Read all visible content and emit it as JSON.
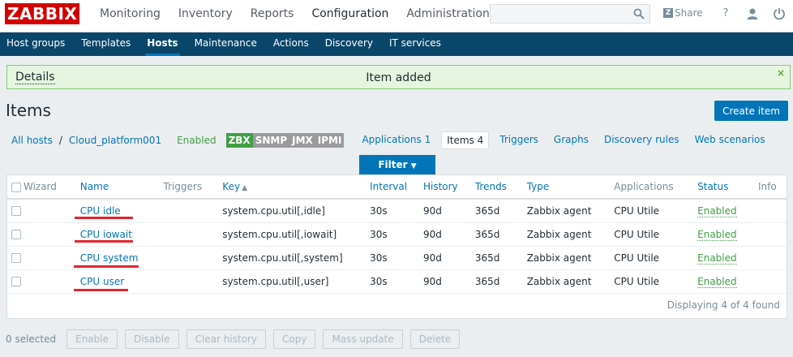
{
  "header": {
    "logo": "ZABBIX",
    "nav": [
      "Monitoring",
      "Inventory",
      "Reports",
      "Configuration",
      "Administration"
    ],
    "active_nav": "Configuration",
    "search_value": "",
    "share_label": "Share",
    "help_icon": "?",
    "share_icon": "Z"
  },
  "subnav": {
    "items": [
      "Host groups",
      "Templates",
      "Hosts",
      "Maintenance",
      "Actions",
      "Discovery",
      "IT services"
    ],
    "active": "Hosts"
  },
  "message": {
    "details": "Details",
    "text": "Item added",
    "close": "×"
  },
  "page": {
    "title": "Items",
    "create_button": "Create item"
  },
  "breadcrumbs": {
    "all_hosts": "All hosts",
    "separator": "/",
    "host": "Cloud_platform001",
    "status": "Enabled",
    "availability": [
      {
        "label": "ZBX",
        "state": "on"
      },
      {
        "label": "SNMP",
        "state": "off"
      },
      {
        "label": "JMX",
        "state": "off"
      },
      {
        "label": "IPMI",
        "state": "off"
      }
    ],
    "tabs": [
      {
        "label": "Applications",
        "count": "1"
      },
      {
        "label": "Items",
        "count": "4"
      },
      {
        "label": "Triggers",
        "count": ""
      },
      {
        "label": "Graphs",
        "count": ""
      },
      {
        "label": "Discovery rules",
        "count": ""
      },
      {
        "label": "Web scenarios",
        "count": ""
      }
    ]
  },
  "filter": {
    "label": "Filter",
    "arrow": "▼"
  },
  "table": {
    "columns": {
      "wizard": "Wizard",
      "name": "Name",
      "triggers": "Triggers",
      "key": "Key",
      "key_sort": "▲",
      "interval": "Interval",
      "history": "History",
      "trends": "Trends",
      "type": "Type",
      "applications": "Applications",
      "status": "Status",
      "info": "Info"
    },
    "rows": [
      {
        "name": "CPU idle",
        "key": "system.cpu.util[,idle]",
        "interval": "30s",
        "history": "90d",
        "trends": "365d",
        "type": "Zabbix agent",
        "applications": "CPU Utile",
        "status": "Enabled"
      },
      {
        "name": "CPU iowait",
        "key": "system.cpu.util[,iowait]",
        "interval": "30s",
        "history": "90d",
        "trends": "365d",
        "type": "Zabbix agent",
        "applications": "CPU Utile",
        "status": "Enabled"
      },
      {
        "name": "CPU system",
        "key": "system.cpu.util[,system]",
        "interval": "30s",
        "history": "90d",
        "trends": "365d",
        "type": "Zabbix agent",
        "applications": "CPU Utile",
        "status": "Enabled"
      },
      {
        "name": "CPU user",
        "key": "system.cpu.util[,user]",
        "interval": "30s",
        "history": "90d",
        "trends": "365d",
        "type": "Zabbix agent",
        "applications": "CPU Utile",
        "status": "Enabled"
      }
    ],
    "footer": "Displaying 4 of 4 found"
  },
  "actions": {
    "selected": "0 selected",
    "buttons": [
      "Enable",
      "Disable",
      "Clear history",
      "Copy",
      "Mass update",
      "Delete"
    ]
  },
  "colors": {
    "brand": "#d40000",
    "subnav": "#0a466a",
    "accent": "#0275b8",
    "enabled": "#429e47",
    "annotation": "#e0262f"
  }
}
